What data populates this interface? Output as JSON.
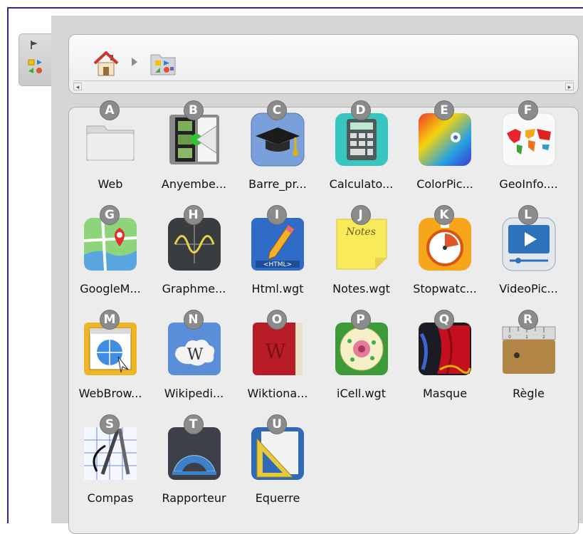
{
  "items": [
    {
      "letter": "A",
      "label": "Web",
      "icon": "folder-icon"
    },
    {
      "letter": "B",
      "label": "Anyembe...",
      "icon": "film-strip-icon"
    },
    {
      "letter": "C",
      "label": "Barre_pr...",
      "icon": "graduation-cap-icon"
    },
    {
      "letter": "D",
      "label": "Calculato...",
      "icon": "calculator-icon"
    },
    {
      "letter": "E",
      "label": "ColorPic...",
      "icon": "color-picker-icon"
    },
    {
      "letter": "F",
      "label": "GeoInfo....",
      "icon": "world-map-icon"
    },
    {
      "letter": "G",
      "label": "GoogleM...",
      "icon": "map-pin-icon"
    },
    {
      "letter": "H",
      "label": "Graphme...",
      "icon": "sine-graph-icon"
    },
    {
      "letter": "I",
      "label": "Html.wgt",
      "icon": "html-pencil-icon"
    },
    {
      "letter": "J",
      "label": "Notes.wgt",
      "icon": "sticky-note-icon"
    },
    {
      "letter": "K",
      "label": "Stopwatc...",
      "icon": "stopwatch-icon"
    },
    {
      "letter": "L",
      "label": "VideoPic...",
      "icon": "video-player-icon"
    },
    {
      "letter": "M",
      "label": "WebBrow...",
      "icon": "web-browser-icon"
    },
    {
      "letter": "N",
      "label": "Wikipedi...",
      "icon": "wikipedia-icon"
    },
    {
      "letter": "O",
      "label": "Wiktiona...",
      "icon": "wiktionary-book-icon"
    },
    {
      "letter": "P",
      "label": "iCell.wgt",
      "icon": "cell-icon"
    },
    {
      "letter": "Q",
      "label": "Masque",
      "icon": "curtain-mask-icon"
    },
    {
      "letter": "R",
      "label": "Règle",
      "icon": "ruler-icon"
    },
    {
      "letter": "S",
      "label": "Compas",
      "icon": "compass-icon"
    },
    {
      "letter": "T",
      "label": "Rapporteur",
      "icon": "protractor-icon"
    },
    {
      "letter": "U",
      "label": "Equerre",
      "icon": "set-square-icon"
    }
  ],
  "breadcrumb": {
    "home_icon": "home-icon",
    "folder_icon": "apps-folder-icon"
  },
  "colors": {
    "frame": "#2b2d86",
    "badge": "#8b8b8b",
    "panel": "#ececec"
  }
}
